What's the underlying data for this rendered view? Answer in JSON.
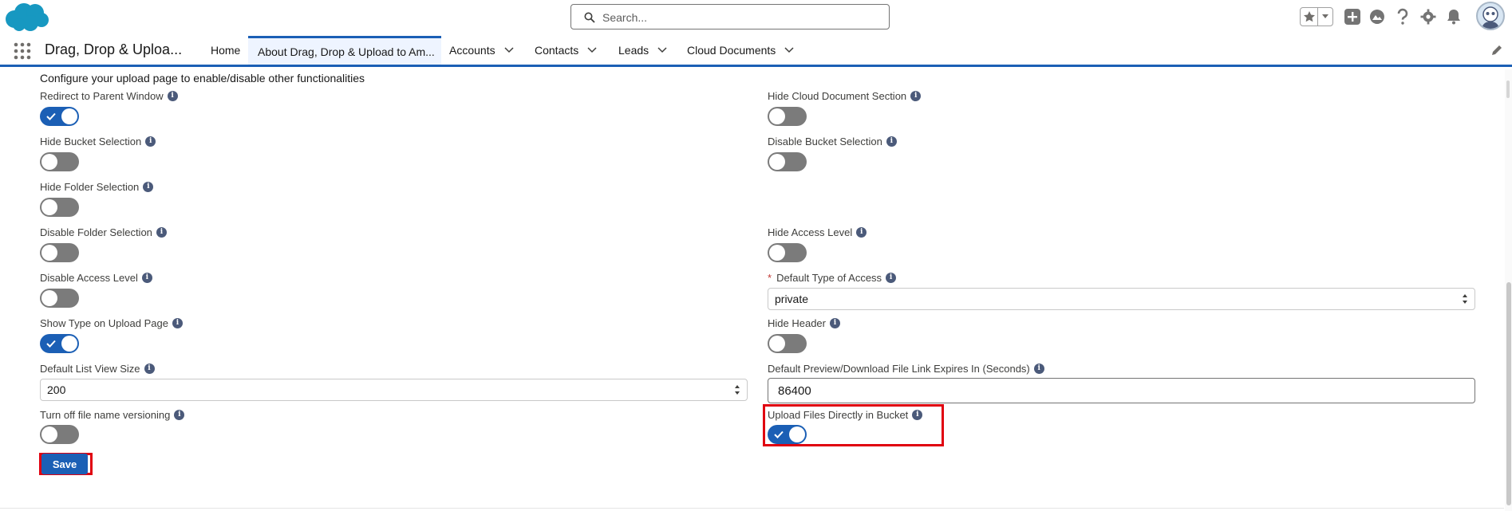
{
  "header": {
    "search_placeholder": "Search...",
    "icons": [
      "salesforce-cloud-logo",
      "search-icon",
      "favorites-star-icon",
      "chevron-down-icon",
      "add-icon",
      "trailhead-icon",
      "help-icon",
      "setup-gear-icon",
      "notification-bell-icon",
      "user-avatar"
    ]
  },
  "nav": {
    "app_name": "Drag, Drop & Uploa...",
    "tabs": [
      {
        "label": "Home"
      },
      {
        "label": "About Drag, Drop & Upload to Am..."
      },
      {
        "label": "Accounts"
      },
      {
        "label": "Contacts"
      },
      {
        "label": "Leads"
      },
      {
        "label": "Cloud Documents"
      }
    ]
  },
  "form": {
    "intro": "Configure your upload page to enable/disable other functionalities",
    "fields": {
      "redirect_parent": {
        "label": "Redirect to Parent Window",
        "on": true
      },
      "hide_cloud_doc": {
        "label": "Hide Cloud Document Section",
        "on": false
      },
      "hide_bucket": {
        "label": "Hide Bucket Selection",
        "on": false
      },
      "disable_bucket": {
        "label": "Disable Bucket Selection",
        "on": false
      },
      "hide_folder": {
        "label": "Hide Folder Selection",
        "on": false
      },
      "disable_folder": {
        "label": "Disable Folder Selection",
        "on": false
      },
      "hide_access": {
        "label": "Hide Access Level",
        "on": false
      },
      "disable_access": {
        "label": "Disable Access Level",
        "on": false
      },
      "default_access": {
        "label": "Default Type of Access",
        "required_mark": "*",
        "value": "private"
      },
      "show_type": {
        "label": "Show Type on Upload Page",
        "on": true
      },
      "hide_header": {
        "label": "Hide Header",
        "on": false
      },
      "list_view_size": {
        "label": "Default List View Size",
        "value": "200"
      },
      "link_expires": {
        "label": "Default Preview/Download File Link Expires In (Seconds)",
        "value": "86400"
      },
      "versioning": {
        "label": "Turn off file name versioning",
        "on": false
      },
      "upload_direct": {
        "label": "Upload Files Directly in Bucket",
        "on": true
      }
    },
    "info_glyph": "i",
    "save_label": "Save"
  },
  "colors": {
    "brand": "#1b5fb5",
    "highlight": "#e0000f",
    "toggle_off": "#7b7b7b"
  }
}
